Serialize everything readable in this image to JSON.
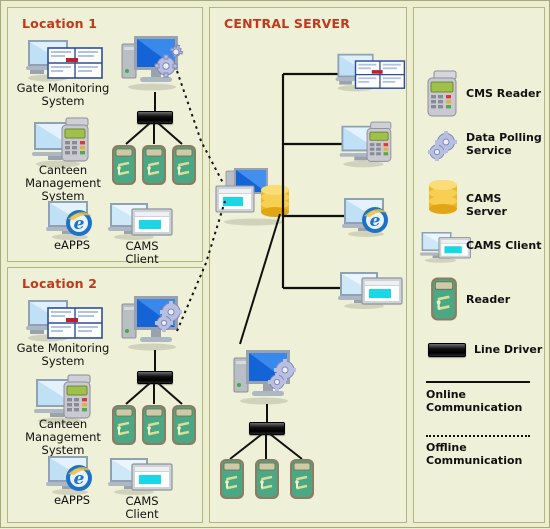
{
  "diagram": {
    "title_colors": {
      "panel_title": "#c0391b",
      "panel_bg": "#eef0d7",
      "page_bg": "#eceed1",
      "panel_border": "#b6b57c"
    }
  },
  "panels": {
    "location1": {
      "title": "Location 1",
      "apps": [
        {
          "icon": "gate-monitoring-icon",
          "label": "Gate Monitoring\nSystem"
        },
        {
          "icon": "canteen-management-icon",
          "label": "Canteen\nManagement\nSystem"
        },
        {
          "icon": "eapps-icon",
          "label": "eAPPS"
        },
        {
          "icon": "cams-client-icon",
          "label": "CAMS\nClient"
        }
      ],
      "labels": {
        "gate": "Gate Monitoring\nSystem",
        "gate_l1": "Gate Monitoring",
        "gate_l2": "System",
        "canteen_l1": "Canteen",
        "canteen_l2": "Management",
        "canteen_l3": "System",
        "eapps": "eAPPS",
        "cams_l1": "CAMS",
        "cams_l2": "Client"
      },
      "devices": {
        "polling_server": "data-polling-server",
        "line_driver": "line-driver",
        "readers": 3
      }
    },
    "location2": {
      "title": "Location 2",
      "labels": {
        "gate_l1": "Gate Monitoring",
        "gate_l2": "System",
        "canteen_l1": "Canteen",
        "canteen_l2": "Management",
        "canteen_l3": "System",
        "eapps": "eAPPS",
        "cams_l1": "CAMS",
        "cams_l2": "Client"
      },
      "devices": {
        "polling_server": "data-polling-server",
        "line_driver": "line-driver",
        "readers": 3
      }
    },
    "central": {
      "title": "CENTRAL SERVER",
      "server": {
        "icon": "cams-server-with-client",
        "database": "cams-server-db"
      },
      "clients": [
        {
          "icon": "gate-monitoring-icon"
        },
        {
          "icon": "canteen-management-icon"
        },
        {
          "icon": "eapps-icon"
        },
        {
          "icon": "cams-client-icon"
        }
      ],
      "local_branch": {
        "polling_server": "data-polling-server",
        "line_driver": "line-driver",
        "readers": 3
      }
    },
    "legend": {
      "items": [
        {
          "icon": "cms-reader-icon",
          "label": "CMS Reader"
        },
        {
          "icon": "data-polling-service-icon",
          "label": "Data Polling\nService",
          "l1": "Data Polling",
          "l2": "Service"
        },
        {
          "icon": "cams-server-icon",
          "label": "CAMS Server"
        },
        {
          "icon": "cams-client-icon",
          "label": "CAMS Client"
        },
        {
          "icon": "reader-icon",
          "label": "Reader"
        },
        {
          "icon": "line-driver-icon",
          "label": "Line Driver"
        }
      ],
      "connections": [
        {
          "style": "solid",
          "l1": "Online",
          "l2": "Communication"
        },
        {
          "style": "dotted",
          "l1": "Offline",
          "l2": "Communication"
        }
      ]
    }
  }
}
